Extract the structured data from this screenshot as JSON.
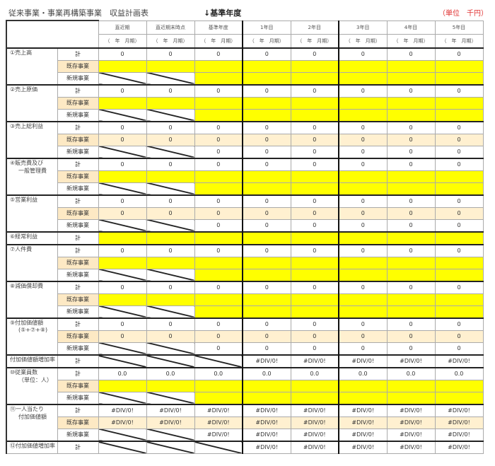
{
  "header": {
    "title": "従来事業・事業再構築事業　収益計画表",
    "base_year_label": "↓基準年度",
    "unit_label": "（単位　千円）"
  },
  "columns": {
    "years": [
      "直近期",
      "直近期末時点",
      "基準年度",
      "1年目",
      "2年目",
      "3年目",
      "4年目",
      "5年目"
    ],
    "periods": [
      "（　年　月期）",
      "（　年　月期）",
      "（　年　月期）",
      "（　年　月期）",
      "（　年　月期）",
      "（　年　月期）",
      "（　年　月期）",
      "（　年　月期）"
    ]
  },
  "sub_labels": {
    "total": "計",
    "existing": "既存事業",
    "new": "新規事業"
  },
  "rows": [
    {
      "name": "①売上高",
      "total": [
        "0",
        "0",
        "0",
        "0",
        "0",
        "0",
        "0",
        "0"
      ]
    },
    {
      "name": "②売上原価",
      "total": [
        "0",
        "0",
        "0",
        "0",
        "0",
        "0",
        "0",
        "0"
      ]
    },
    {
      "name": "③売上総利益",
      "total": [
        "0",
        "0",
        "0",
        "0",
        "0",
        "0",
        "0",
        "0"
      ],
      "existing": [
        "0",
        "0",
        "0",
        "0",
        "0",
        "0",
        "0",
        "0"
      ],
      "new": [
        "",
        "",
        "0",
        "0",
        "0",
        "0",
        "0",
        "0"
      ]
    },
    {
      "name": "④販売費及び",
      "name2": "一般管理費",
      "total": [
        "0",
        "0",
        "0",
        "0",
        "0",
        "0",
        "0",
        "0"
      ]
    },
    {
      "name": "⑤営業利益",
      "total": [
        "0",
        "0",
        "0",
        "0",
        "0",
        "0",
        "0",
        "0"
      ],
      "existing": [
        "0",
        "0",
        "0",
        "0",
        "0",
        "0",
        "0",
        "0"
      ],
      "new": [
        "",
        "",
        "0",
        "0",
        "0",
        "0",
        "0",
        "0"
      ]
    },
    {
      "name": "⑥経常利益",
      "total": []
    },
    {
      "name": "⑦人件費",
      "total": [
        "0",
        "0",
        "0",
        "0",
        "0",
        "0",
        "0",
        "0"
      ]
    },
    {
      "name": "⑧減価償却費",
      "total": [
        "0",
        "0",
        "0",
        "0",
        "0",
        "0",
        "0",
        "0"
      ]
    },
    {
      "name": "⑨付加価値額",
      "name2": "(⑤+⑦+⑧)",
      "total": [
        "0",
        "0",
        "0",
        "0",
        "0",
        "0",
        "0",
        "0"
      ],
      "existing": [
        "0",
        "0",
        "0",
        "0",
        "0",
        "0",
        "0",
        "0"
      ],
      "new": [
        "",
        "",
        "0",
        "0",
        "0",
        "0",
        "0",
        "0"
      ]
    },
    {
      "name": "付加価値額増加率",
      "total": [
        "",
        "",
        "",
        "#DIV/0!",
        "#DIV/0!",
        "#DIV/0!",
        "#DIV/0!",
        "#DIV/0!"
      ]
    },
    {
      "name": "⑩従業員数",
      "name2": "（単位：人）",
      "total": [
        "0.0",
        "0.0",
        "0.0",
        "0.0",
        "0.0",
        "0.0",
        "0.0",
        "0.0"
      ]
    },
    {
      "name": "⑪一人当たり",
      "name2": "付加価値額",
      "total": [
        "#DIV/0!",
        "#DIV/0!",
        "#DIV/0!",
        "#DIV/0!",
        "#DIV/0!",
        "#DIV/0!",
        "#DIV/0!",
        "#DIV/0!"
      ],
      "existing": [
        "#DIV/0!",
        "#DIV/0!",
        "#DIV/0!",
        "#DIV/0!",
        "#DIV/0!",
        "#DIV/0!",
        "#DIV/0!",
        "#DIV/0!"
      ],
      "new": [
        "",
        "",
        "#DIV/0!",
        "#DIV/0!",
        "#DIV/0!",
        "#DIV/0!",
        "#DIV/0!",
        "#DIV/0!"
      ]
    },
    {
      "name": "⑫付加価値増加率",
      "total": [
        "",
        "",
        "",
        "#DIV/0!",
        "#DIV/0!",
        "#DIV/0!",
        "#DIV/0!",
        "#DIV/0!"
      ]
    }
  ]
}
